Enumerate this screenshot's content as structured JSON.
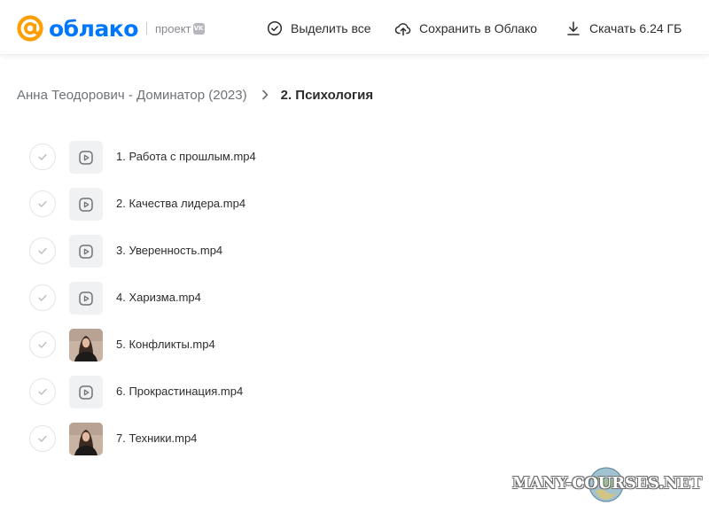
{
  "header": {
    "logo_text": "облако",
    "project_label": "проект",
    "vk_badge": "VK",
    "select_all_label": "Выделить все",
    "save_label": "Сохранить в Облако",
    "download_label": "Скачать 6.24 ГБ",
    "brand_color": "#0077ff",
    "logo_accent_color": "#ff9e00"
  },
  "breadcrumb": {
    "parent": "Анна Теодорович - Доминатор (2023)",
    "current": "2. Психология"
  },
  "files": [
    {
      "name": "1. Работа с прошлым.mp4",
      "thumbnail": "play-icon"
    },
    {
      "name": "2. Качества лидера.mp4",
      "thumbnail": "play-icon"
    },
    {
      "name": "3. Уверенность.mp4",
      "thumbnail": "play-icon"
    },
    {
      "name": "4. Харизма.mp4",
      "thumbnail": "play-icon"
    },
    {
      "name": "5. Конфликты.mp4",
      "thumbnail": "video-preview"
    },
    {
      "name": "6. Прокрастинация.mp4",
      "thumbnail": "play-icon"
    },
    {
      "name": "7. Техники.mp4",
      "thumbnail": "video-preview"
    }
  ],
  "watermark": {
    "text": "MANY-COURSES.NET"
  }
}
